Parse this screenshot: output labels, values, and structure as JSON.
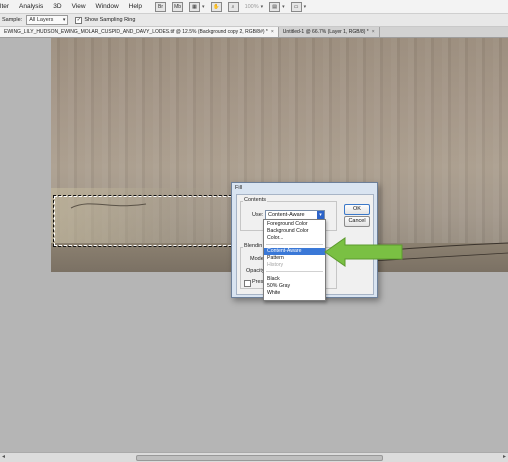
{
  "menubar": {
    "items": [
      "lter",
      "Analysis",
      "3D",
      "View",
      "Window",
      "Help"
    ],
    "zoom_label": "100%"
  },
  "options": {
    "sample_label": "Sample:",
    "sample_value": "All Layers",
    "ring_label": "Show Sampling Ring"
  },
  "tabs": [
    {
      "label": "EWING_LILY_HUDSON_EWING_MOLAR_CUSPID_AND_DAVY_LODES.tif @ 12.5% (Background copy 2, RGB/8#) *",
      "close": "×"
    },
    {
      "label": "Untitled-1 @ 66.7% (Layer 1, RGB/8) *",
      "close": "×"
    }
  ],
  "dialog": {
    "title": "Fill",
    "contents_label": "Contents",
    "use_label": "Use:",
    "use_value": "Content-Aware",
    "blending_label": "Blendin",
    "mode_label": "Mode:",
    "opacity_label": "Opacity:",
    "preserve_label": "Preser",
    "ok_label": "OK",
    "cancel_label": "Cancel"
  },
  "dropdown": {
    "items": [
      {
        "label": "Foreground Color",
        "state": "normal"
      },
      {
        "label": "Background Color",
        "state": "normal"
      },
      {
        "label": "Color...",
        "state": "normal"
      },
      {
        "label": "Content-Aware",
        "state": "highlighted"
      },
      {
        "label": "Pattern",
        "state": "normal"
      },
      {
        "label": "History",
        "state": "disabled"
      },
      {
        "label": "Black",
        "state": "normal"
      },
      {
        "label": "50% Gray",
        "state": "normal"
      },
      {
        "label": "White",
        "state": "normal"
      }
    ]
  },
  "colors": {
    "highlight": "#3a78d7",
    "arrow": "#7ac043",
    "dialog_frame": "#d9e4f1"
  }
}
